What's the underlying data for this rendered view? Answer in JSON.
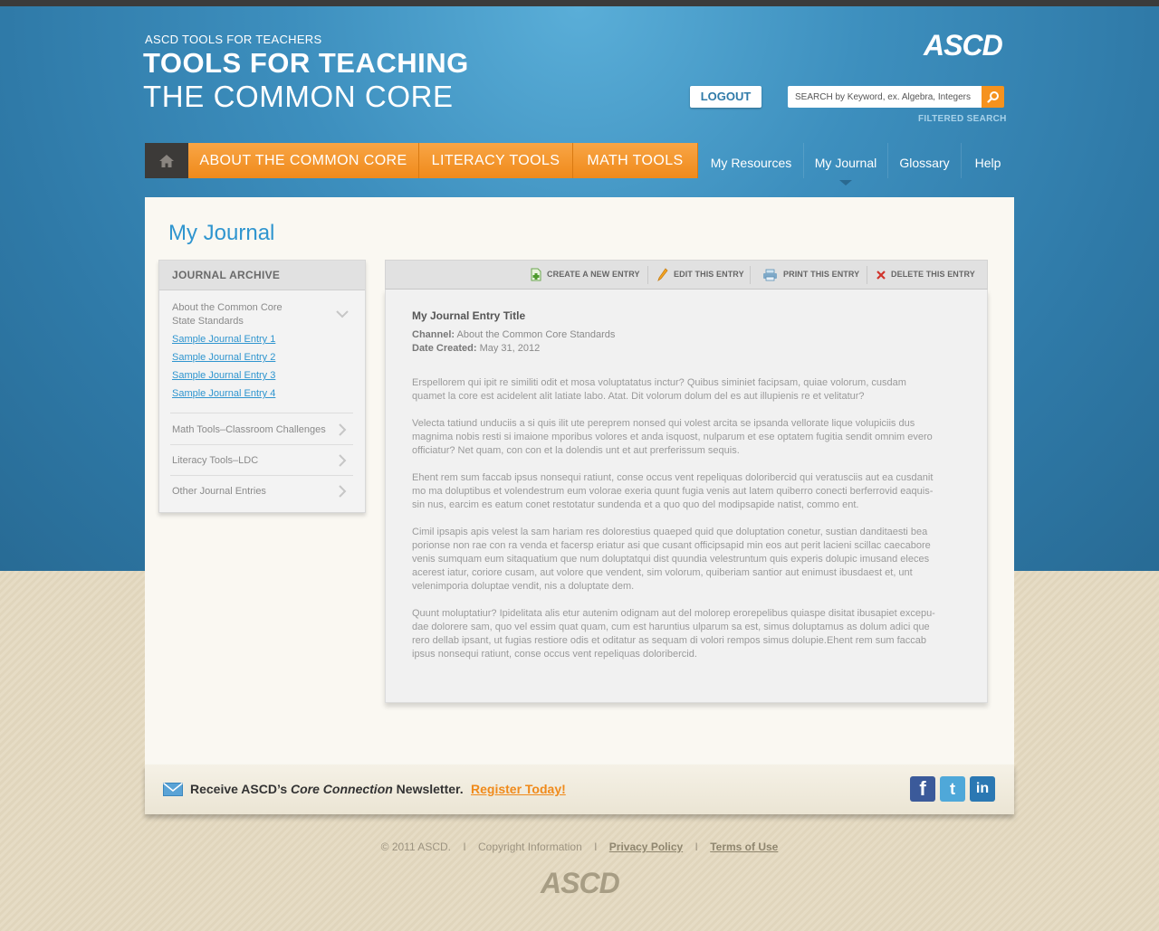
{
  "header": {
    "brand_small": "ASCD TOOLS FOR TEACHERS",
    "brand_line1": "TOOLS FOR TEACHING",
    "brand_line2": "THE COMMON CORE",
    "logo": "ASCD",
    "logout_label": "LOGOUT",
    "search_placeholder": "SEARCH by Keyword, ex. Algebra, Integers",
    "filtered_search": "FILTERED SEARCH"
  },
  "nav": {
    "home_icon": "home-icon",
    "orange_items": [
      "ABOUT THE COMMON CORE",
      "LITERACY TOOLS",
      "MATH TOOLS"
    ],
    "blue_items": [
      "My Resources",
      "My Journal",
      "Glossary",
      "Help"
    ],
    "active": "My Journal"
  },
  "page": {
    "title": "My Journal"
  },
  "archive": {
    "heading": "JOURNAL ARCHIVE",
    "expanded_section": {
      "label_line1": "About the Common Core",
      "label_line2": "State Standards",
      "entries": [
        "Sample Journal Entry 1",
        "Sample Journal Entry 2",
        "Sample Journal Entry 3",
        "Sample Journal Entry 4"
      ]
    },
    "sections": [
      "Math Tools–Classroom Challenges",
      "Literacy Tools–LDC",
      "Other Journal Entries"
    ]
  },
  "toolbar": {
    "create": "CREATE A NEW ENTRY",
    "edit": "EDIT THIS ENTRY",
    "print": "PRINT THIS ENTRY",
    "delete": "DELETE THIS ENTRY"
  },
  "entry": {
    "title": "My Journal Entry Title",
    "channel_label": "Channel:",
    "channel_value": "About the Common Core Standards",
    "date_label": "Date Created:",
    "date_value": "May 31, 2012",
    "paragraphs": [
      "Erspellorem qui ipit re similiti odit et mosa voluptatatus inctur? Quibus siminiet facipsam, quiae volorum, cusdam quamet la core est acidelent alit latiate labo. Atat. Dit volorum dolum del es aut illupienis re et velitatur?",
      "Velecta tatiund unduciis a si quis ilit ute pereprem nonsed qui volest arcita se ipsanda vellorate lique volupiciis dus magnima nobis resti si imaione mporibus volores et anda isquost, nulparum et ese optatem fugitia sendit omnim evero officiatur? Net quam, con con et la dolendis unt et aut prerferissum sequis.",
      "Ehent rem sum faccab ipsus nonsequi ratiunt, conse occus vent repeliquas doloribercid qui veratusciis aut ea cusdanit mo ma doluptibus et volendestrum eum volorae exeria quunt fugia venis aut latem quiberro conecti berferrovid eaquis-sin nus, earcim es eatum conet restotatur sundenda et a quo quo del modipsapide natist, commo ent.",
      "Cimil ipsapis apis velest la sam hariam res dolorestius quaeped quid que doluptation conetur, sustian danditaesti bea porionse non rae con ra venda et facersp eriatur asi que cusant officipsapid min eos aut perit lacieni scillac caecabore venis sumquam eum sitaquatium que num doluptatqui dist quundia velestruntum quis experis dolupic imusand eleces acerest iatur, coriore cusam, aut volore que vendent, sim volorum, quiberiam santior aut enimust ibusdaest et, unt velenimporia doluptae vendit, nis a doluptate dem.",
      "Quunt moluptatiur? Ipidelitata alis etur autenim odignam aut del molorep erorepelibus quiaspe disitat ibusapiet excepu-dae dolorere sam, quo vel essim quat quam, cum est haruntius ulparum sa est, simus doluptamus as dolum adici que rero dellab ipsant, ut fugias restiore odis et oditatur as sequam di volori rempos simus dolupie.Ehent rem sum faccab ipsus nonsequi ratiunt, conse occus vent repeliquas doloribercid."
    ]
  },
  "newsletter": {
    "prefix": "Receive ASCD’s ",
    "emph": "Core Connection",
    "suffix": " Newsletter.",
    "register": "Register Today!"
  },
  "social": {
    "facebook": "f",
    "twitter": "t",
    "linkedin": "in"
  },
  "footer": {
    "copyright": "© 2011 ASCD.",
    "copyright_info": "Copyright Information",
    "privacy": "Privacy Policy",
    "terms": "Terms of Use",
    "logo": "ASCD"
  },
  "colors": {
    "header_blue": "#2f7aa8",
    "nav_orange": "#f08a1b",
    "link_blue": "#2f95cf",
    "beige": "#e5dcc6"
  }
}
